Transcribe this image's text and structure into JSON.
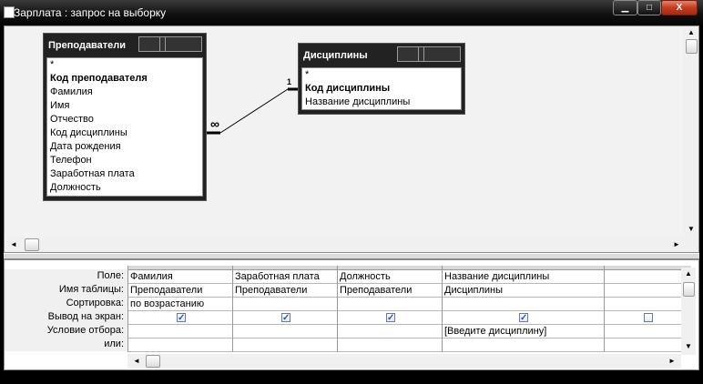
{
  "window": {
    "title": "Зарплата : запрос на выборку",
    "buttons": {
      "minimize": "▁",
      "maximize": "□",
      "close": "X"
    }
  },
  "tables": [
    {
      "name": "Преподаватели",
      "fields": [
        {
          "label": "*",
          "key": false
        },
        {
          "label": "Код преподавателя",
          "key": true
        },
        {
          "label": "Фамилия",
          "key": false
        },
        {
          "label": "Имя",
          "key": false
        },
        {
          "label": "Отчество",
          "key": false
        },
        {
          "label": "Код дисциплины",
          "key": false
        },
        {
          "label": "Дата рождения",
          "key": false
        },
        {
          "label": "Телефон",
          "key": false
        },
        {
          "label": "Заработная плата",
          "key": false
        },
        {
          "label": "Должность",
          "key": false
        }
      ]
    },
    {
      "name": "Дисциплины",
      "fields": [
        {
          "label": "*",
          "key": false
        },
        {
          "label": "Код дисциплины",
          "key": true
        },
        {
          "label": "Название дисциплины",
          "key": false
        }
      ]
    }
  ],
  "relationship": {
    "one_side": "1",
    "many_side": "∞"
  },
  "grid": {
    "row_labels": [
      "Поле:",
      "Имя таблицы:",
      "Сортировка:",
      "Вывод на экран:",
      "Условие отбора:",
      "или:"
    ],
    "columns": [
      {
        "field": "Фамилия",
        "table": "Преподаватели",
        "sort": "по возрастанию",
        "show": true,
        "criteria": "",
        "or": ""
      },
      {
        "field": "Заработная плата",
        "table": "Преподаватели",
        "sort": "",
        "show": true,
        "criteria": "",
        "or": ""
      },
      {
        "field": "Должность",
        "table": "Преподаватели",
        "sort": "",
        "show": true,
        "criteria": "",
        "or": ""
      },
      {
        "field": "Название дисциплины",
        "table": "Дисциплины",
        "sort": "",
        "show": true,
        "criteria": "[Введите дисциплину]",
        "or": ""
      },
      {
        "field": "",
        "table": "",
        "sort": "",
        "show": false,
        "criteria": "",
        "or": ""
      }
    ]
  },
  "scroll_arrows": {
    "up": "▲",
    "down": "▼",
    "left": "◄",
    "right": "►"
  }
}
